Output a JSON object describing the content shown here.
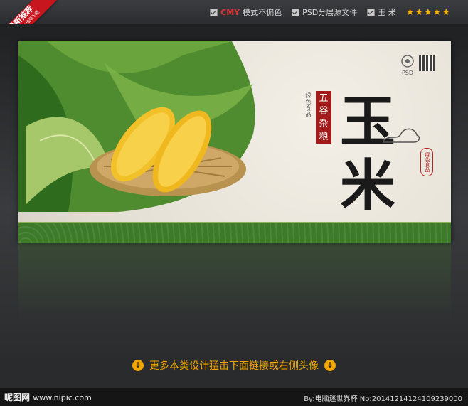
{
  "topbar": {
    "features": [
      {
        "label": "CMY",
        "suffix": "模式不偏色"
      },
      {
        "label": "PSD分层源文件"
      },
      {
        "label": "玉 米"
      }
    ],
    "stars": "★★★★★"
  },
  "corner": {
    "label": "最新推荐",
    "sub": "精品设计 值得下载"
  },
  "banner": {
    "title_top": "玉",
    "title_bottom": "米",
    "slogan": "五谷杂粮",
    "vertical_text": "绿色食品",
    "seal": "绿色食品",
    "logo": "PSD"
  },
  "footer": {
    "link_text": "更多本类设计猛击下面链接或右侧头像"
  },
  "bottombar": {
    "brand": "昵图网",
    "url": "www.nipic.com",
    "byline": "By:电脑迷世界杯 No:20141214124109239000"
  },
  "colors": {
    "accent": "#f2a700",
    "brand_red": "#c8161e",
    "band_green": "#3d7a2a"
  }
}
